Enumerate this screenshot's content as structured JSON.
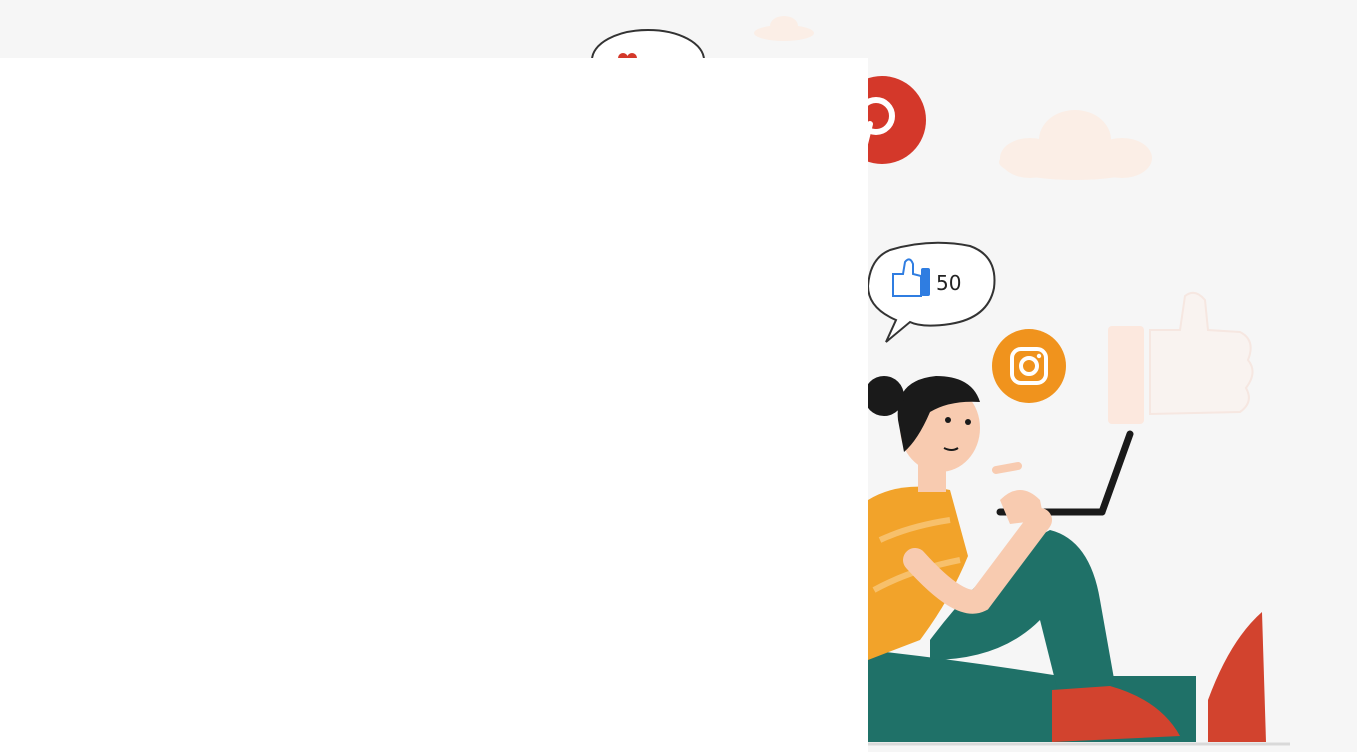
{
  "illustration": {
    "like_bubble": {
      "icon": "thumbs-up-icon",
      "count": "50"
    },
    "icons": [
      "pinterest-icon",
      "instagram-icon",
      "heart-icon",
      "thumbs-up-icon",
      "cloud-icon"
    ]
  },
  "colors": {
    "background": "#f6f6f6",
    "blank_panel": "#ffffff",
    "pinterest_red": "#d4382a",
    "instagram_orange": "#f0931d",
    "like_blue": "#2f7de1",
    "shirt_orange": "#f2a32a",
    "pants_teal": "#1f7168",
    "shoe_red": "#d2432e",
    "cloud_peach": "#fbeee6"
  }
}
